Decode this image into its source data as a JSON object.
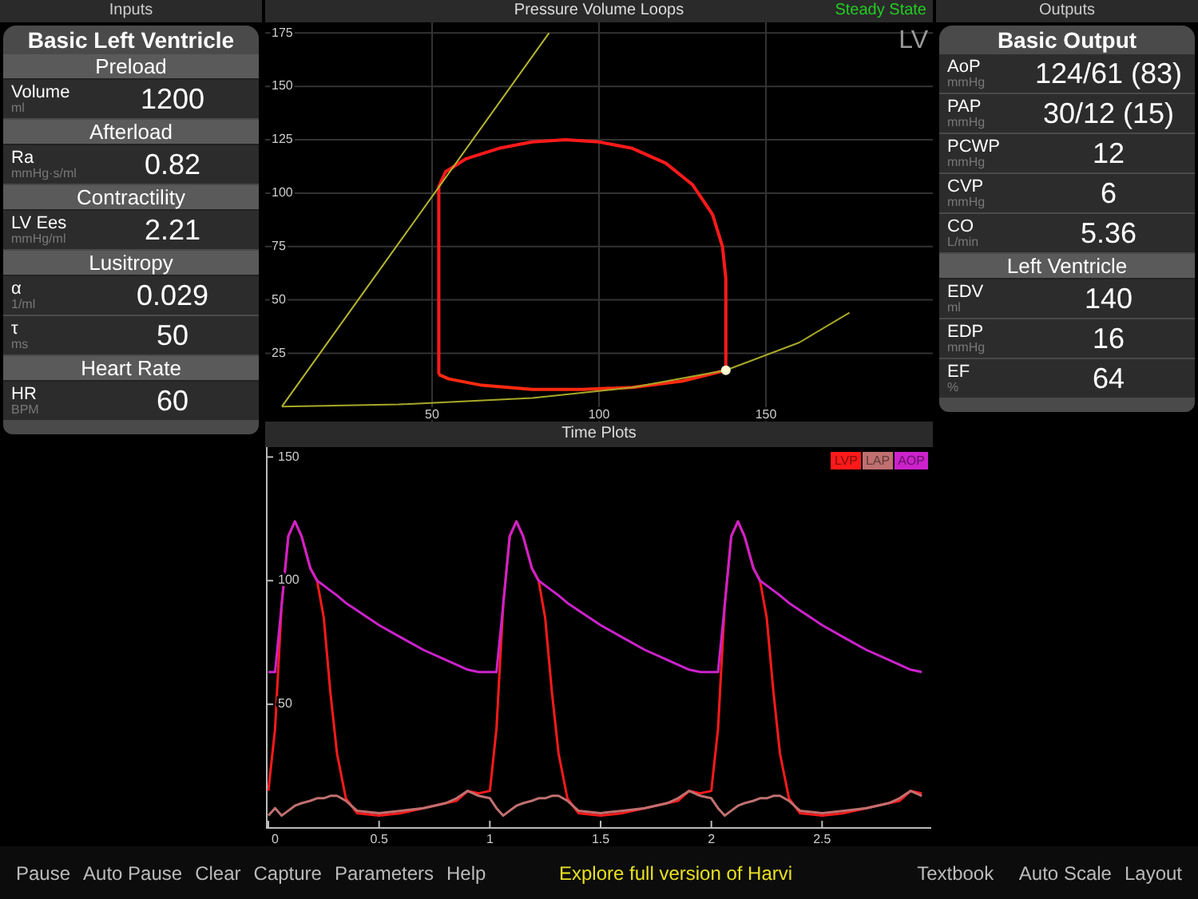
{
  "inputs": {
    "header": "Inputs",
    "title": "Basic Left Ventricle",
    "rows": [
      {
        "kind": "section",
        "label": "Preload"
      },
      {
        "kind": "param",
        "label": "Volume",
        "unit": "ml",
        "value": "1200"
      },
      {
        "kind": "section",
        "label": "Afterload"
      },
      {
        "kind": "param",
        "label": "Ra",
        "unit": "mmHg·s/ml",
        "value": "0.82"
      },
      {
        "kind": "section",
        "label": "Contractility"
      },
      {
        "kind": "param",
        "label": "LV Ees",
        "unit": "mmHg/ml",
        "value": "2.21"
      },
      {
        "kind": "section",
        "label": "Lusitropy"
      },
      {
        "kind": "param",
        "label": "α",
        "unit": "1/ml",
        "value": "0.029"
      },
      {
        "kind": "param",
        "label": "τ",
        "unit": "ms",
        "value": "50"
      },
      {
        "kind": "section",
        "label": "Heart Rate"
      },
      {
        "kind": "param",
        "label": "HR",
        "unit": "BPM",
        "value": "60"
      }
    ]
  },
  "pv_loops": {
    "header": "Pressure Volume Loops",
    "status": "Steady State",
    "label": "LV",
    "chart_data": {
      "type": "line",
      "grid": true,
      "xlim": [
        0,
        200
      ],
      "ylim": [
        -7,
        180
      ],
      "xticks": [
        50,
        100,
        150
      ],
      "yticks": [
        25,
        50,
        75,
        100,
        125,
        150,
        175
      ],
      "series": [
        {
          "color": "#ff1a1a",
          "x": [
            52,
            52,
            54,
            60,
            70,
            80,
            90,
            100,
            110,
            120,
            128,
            134,
            137,
            138,
            138
          ],
          "values": [
            15,
            103,
            110,
            116,
            121,
            124,
            125,
            124,
            121,
            114,
            104,
            90,
            75,
            60,
            17
          ]
        },
        {
          "color": "#ff2a10",
          "x": [
            52,
            55,
            65,
            80,
            95,
            110,
            125,
            138
          ],
          "values": [
            15,
            13,
            10,
            8,
            8,
            9,
            12,
            17
          ]
        },
        {
          "color": "#b5b530",
          "x": [
            5,
            85
          ],
          "values": [
            0,
            175
          ]
        },
        {
          "color": "#a8a828",
          "x": [
            5,
            40,
            80,
            110,
            138,
            160,
            175
          ],
          "values": [
            0,
            1,
            4,
            9,
            17,
            30,
            44
          ]
        }
      ]
    }
  },
  "time_plots": {
    "header": "Time Plots",
    "chart_data": {
      "type": "line",
      "xlim": [
        0,
        3
      ],
      "ylim": [
        0,
        154
      ],
      "xticks": [
        0,
        0.5,
        1,
        1.5,
        2,
        2.5
      ],
      "yticks": [
        50,
        100,
        150
      ],
      "x": [
        0,
        0.03,
        0.06,
        0.09,
        0.12,
        0.15,
        0.19,
        0.22,
        0.25,
        0.28,
        0.31,
        0.35,
        0.4,
        0.5,
        0.6,
        0.7,
        0.8,
        0.85,
        0.9,
        0.95,
        1,
        1.03,
        1.06,
        1.09,
        1.12,
        1.15,
        1.19,
        1.22,
        1.25,
        1.28,
        1.31,
        1.35,
        1.4,
        1.5,
        1.6,
        1.7,
        1.8,
        1.85,
        1.9,
        1.95,
        2,
        2.03,
        2.06,
        2.09,
        2.12,
        2.15,
        2.19,
        2.22,
        2.25,
        2.28,
        2.31,
        2.35,
        2.4,
        2.5,
        2.6,
        2.7,
        2.8,
        2.85,
        2.9,
        2.95
      ],
      "series": [
        {
          "name": "LVP",
          "color": "#ff1a1a",
          "values": [
            15,
            40,
            90,
            118,
            124,
            118,
            105,
            100,
            85,
            55,
            30,
            12,
            6,
            5,
            6,
            8,
            10,
            11,
            15,
            14,
            15,
            40,
            90,
            118,
            124,
            118,
            105,
            100,
            85,
            55,
            30,
            12,
            6,
            5,
            6,
            8,
            10,
            11,
            15,
            14,
            15,
            40,
            90,
            118,
            124,
            118,
            105,
            100,
            85,
            55,
            30,
            12,
            6,
            5,
            6,
            8,
            10,
            11,
            15,
            14
          ]
        },
        {
          "name": "LAP",
          "color": "#c07070",
          "values": [
            5,
            8,
            5,
            7,
            9,
            10,
            11,
            12,
            12,
            13,
            13,
            11,
            7,
            6,
            7,
            8,
            10,
            12,
            15,
            13,
            12,
            8,
            5,
            7,
            9,
            10,
            11,
            12,
            12,
            13,
            13,
            11,
            7,
            6,
            7,
            8,
            10,
            12,
            15,
            13,
            12,
            8,
            5,
            7,
            9,
            10,
            11,
            12,
            12,
            13,
            13,
            11,
            7,
            6,
            7,
            8,
            10,
            12,
            15,
            13
          ]
        },
        {
          "name": "AOP",
          "color": "#cc22cc",
          "values": [
            63,
            63,
            90,
            118,
            124,
            118,
            105,
            100,
            98,
            96,
            94,
            91,
            88,
            82,
            77,
            72,
            68,
            66,
            64,
            63,
            63,
            63,
            90,
            118,
            124,
            118,
            105,
            100,
            98,
            96,
            94,
            91,
            88,
            82,
            77,
            72,
            68,
            66,
            64,
            63,
            63,
            63,
            90,
            118,
            124,
            118,
            105,
            100,
            98,
            96,
            94,
            91,
            88,
            82,
            77,
            72,
            68,
            66,
            64,
            63
          ]
        }
      ]
    }
  },
  "outputs": {
    "header": "Outputs",
    "title": "Basic Output",
    "rows": [
      {
        "kind": "param",
        "label": "AoP",
        "unit": "mmHg",
        "value": "124/61 (83)"
      },
      {
        "kind": "param",
        "label": "PAP",
        "unit": "mmHg",
        "value": "30/12 (15)"
      },
      {
        "kind": "param",
        "label": "PCWP",
        "unit": "mmHg",
        "value": "12"
      },
      {
        "kind": "param",
        "label": "CVP",
        "unit": "mmHg",
        "value": "6"
      },
      {
        "kind": "param",
        "label": "CO",
        "unit": "L/min",
        "value": "5.36"
      },
      {
        "kind": "section",
        "label": "Left Ventricle"
      },
      {
        "kind": "param",
        "label": "EDV",
        "unit": "ml",
        "value": "140"
      },
      {
        "kind": "param",
        "label": "EDP",
        "unit": "mmHg",
        "value": "16"
      },
      {
        "kind": "param",
        "label": "EF",
        "unit": "%",
        "value": "64"
      }
    ]
  },
  "toolbar": {
    "left": [
      "Pause",
      "Auto Pause",
      "Clear",
      "Capture",
      "Parameters",
      "Help"
    ],
    "promo": "Explore full version of Harvi",
    "middle": "Textbook",
    "right": [
      "Auto Scale",
      "Layout"
    ]
  }
}
